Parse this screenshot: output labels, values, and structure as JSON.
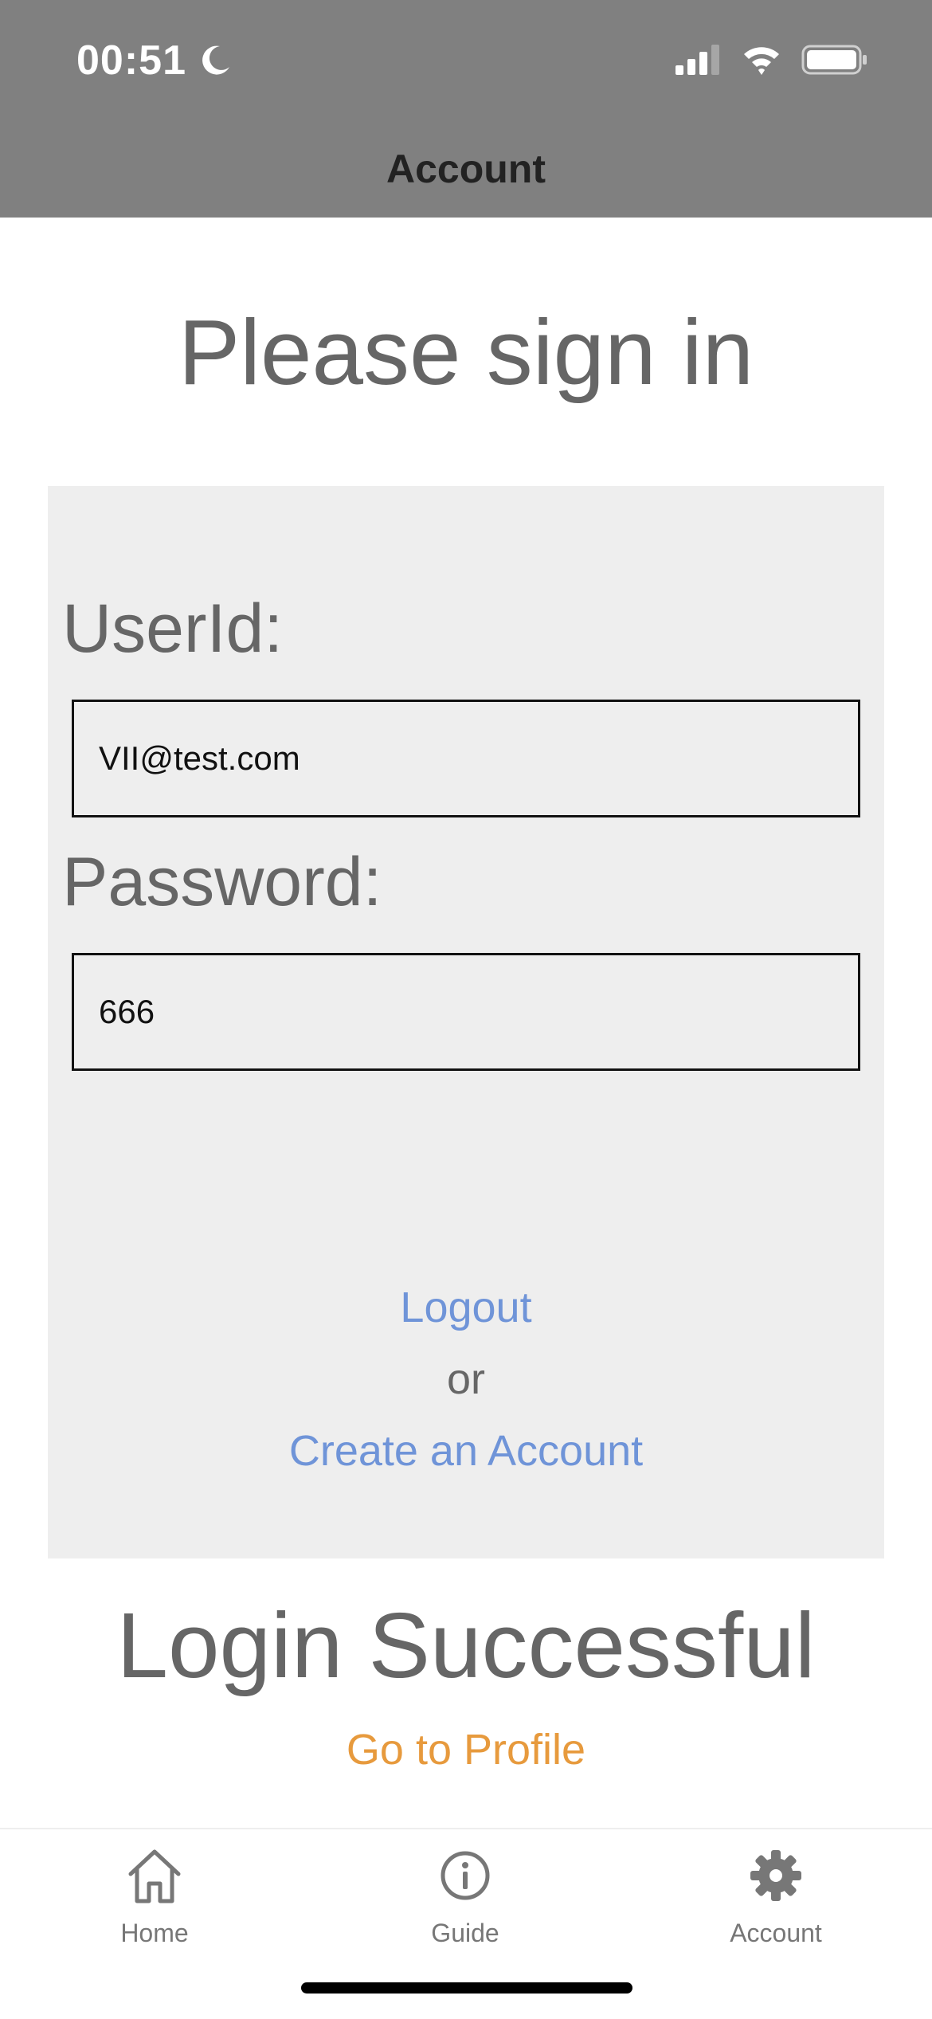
{
  "status_bar": {
    "time": "00:51",
    "icons": [
      "moon-icon",
      "cellular-signal-icon",
      "wifi-icon",
      "battery-icon"
    ]
  },
  "nav": {
    "title": "Account"
  },
  "page": {
    "title": "Please sign in"
  },
  "form": {
    "userid_label": "UserId:",
    "userid_value": "VII@test.com",
    "password_label": "Password:",
    "password_value": "666",
    "logout_link": "Logout",
    "or_text": "or",
    "create_account_link": "Create an Account"
  },
  "result": {
    "status_text": "Login Successful",
    "profile_link": "Go to Profile"
  },
  "tabs": [
    {
      "label": "Home",
      "icon": "home-icon"
    },
    {
      "label": "Guide",
      "icon": "info-icon"
    },
    {
      "label": "Account",
      "icon": "gear-icon",
      "active": true
    }
  ],
  "colors": {
    "header_background": "#808080",
    "panel_background": "#eeeeee",
    "link": "#6f94d8",
    "profile_link": "#e79a3d",
    "text": "#666666"
  }
}
